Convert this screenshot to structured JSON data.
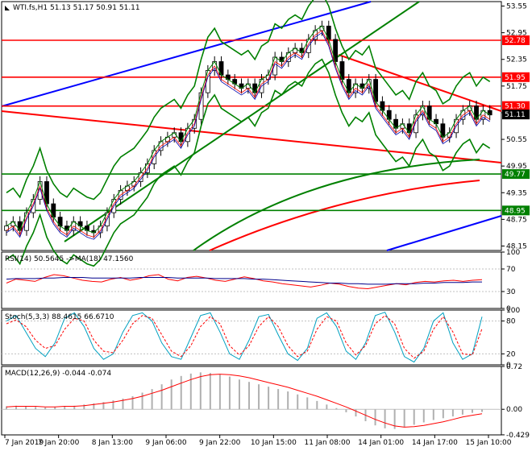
{
  "chart_data": [
    {
      "type": "candlestick",
      "title": "WTI.fs,H1  51.13 51.17 50.91 51.11",
      "symbol_text": "WTI.fs,H1",
      "ohlc_text": "51.13 51.17 50.91 51.11",
      "y_ticks": [
        "53.55",
        "52.95",
        "52.35",
        "51.75",
        "51.15",
        "50.55",
        "49.95",
        "49.35",
        "48.75",
        "48.15"
      ],
      "ylim": [
        48.05,
        53.65
      ],
      "horizontal_levels": [
        {
          "value": 52.78,
          "label": "52.78",
          "color": "#ff0000"
        },
        {
          "value": 51.95,
          "label": "51.95",
          "color": "#ff0000"
        },
        {
          "value": 51.3,
          "label": "51.30",
          "color": "#ff0000"
        },
        {
          "value": 49.77,
          "label": "49.77",
          "color": "#008000"
        },
        {
          "value": 48.95,
          "label": "48.95",
          "color": "#008000"
        }
      ],
      "current_price": {
        "value": 51.11,
        "label": "51.11"
      },
      "x_labels": [
        "7 Jan 2019",
        "7 Jan 20:00",
        "8 Jan 13:00",
        "9 Jan 06:00",
        "9 Jan 22:00",
        "10 Jan 15:00",
        "11 Jan 08:00",
        "14 Jan 01:00",
        "14 Jan 17:00",
        "15 Jan 10:00"
      ],
      "close_series": [
        48.6,
        48.7,
        48.5,
        48.9,
        49.2,
        49.6,
        49.1,
        48.8,
        48.6,
        48.5,
        48.7,
        48.6,
        48.5,
        48.45,
        48.6,
        48.9,
        49.2,
        49.4,
        49.5,
        49.6,
        49.8,
        50.0,
        50.3,
        50.5,
        50.6,
        50.7,
        50.5,
        50.8,
        51.0,
        51.6,
        52.1,
        52.3,
        52.0,
        51.9,
        51.8,
        51.7,
        51.8,
        51.6,
        51.9,
        52.0,
        52.4,
        52.3,
        52.5,
        52.6,
        52.5,
        52.8,
        53.0,
        53.1,
        52.8,
        52.3,
        51.9,
        51.6,
        51.8,
        51.7,
        51.9,
        51.4,
        51.2,
        51.0,
        50.8,
        50.9,
        50.7,
        51.1,
        51.3,
        51.0,
        50.9,
        50.6,
        50.7,
        51.0,
        51.2,
        51.3,
        51.0,
        51.2,
        51.1
      ]
    },
    {
      "type": "line",
      "title": "RSI(14) 50.5645  ->MA(18) 47.1560",
      "y_ticks": [
        "100",
        "70",
        "30",
        "0"
      ],
      "ylim": [
        0,
        100
      ],
      "series": [
        {
          "name": "RSI(14)",
          "color": "#ff0000",
          "values": [
            45,
            52,
            50,
            48,
            55,
            60,
            58,
            54,
            50,
            48,
            47,
            52,
            55,
            50,
            53,
            58,
            60,
            52,
            49,
            55,
            57,
            54,
            50,
            48,
            52,
            56,
            53,
            49,
            47,
            44,
            42,
            40,
            38,
            41,
            45,
            43,
            39,
            36,
            35,
            38,
            41,
            44,
            42,
            46,
            48,
            47,
            49,
            50,
            48,
            50,
            51
          ]
        },
        {
          "name": "MA(18)",
          "color": "#00008b",
          "values": [
            52,
            53,
            53,
            53,
            54,
            54,
            55,
            55,
            55,
            54,
            54,
            54,
            54,
            54,
            55,
            55,
            55,
            55,
            54,
            54,
            54,
            54,
            53,
            53,
            53,
            53,
            52,
            52,
            51,
            50,
            49,
            48,
            47,
            46,
            45,
            45,
            44,
            44,
            43,
            43,
            43,
            44,
            44,
            44,
            45,
            45,
            46,
            46,
            46,
            47,
            47
          ]
        }
      ]
    },
    {
      "type": "line",
      "title": "Stoch(5,3,3) 88.4615 66.6710",
      "y_ticks": [
        "100",
        "80",
        "20",
        "0"
      ],
      "ylim": [
        0,
        100
      ],
      "series": [
        {
          "name": "%K",
          "color": "#00a0c0",
          "values": [
            80,
            90,
            60,
            30,
            15,
            40,
            85,
            95,
            70,
            30,
            10,
            20,
            60,
            90,
            95,
            80,
            40,
            15,
            10,
            50,
            90,
            95,
            60,
            20,
            10,
            45,
            88,
            92,
            55,
            20,
            8,
            30,
            85,
            95,
            70,
            25,
            10,
            40,
            90,
            96,
            60,
            15,
            5,
            30,
            80,
            95,
            40,
            10,
            20,
            88
          ]
        },
        {
          "name": "%D",
          "color": "#ff0000",
          "values": [
            75,
            82,
            70,
            45,
            30,
            35,
            65,
            85,
            80,
            45,
            25,
            22,
            45,
            75,
            90,
            85,
            55,
            25,
            15,
            35,
            70,
            88,
            75,
            35,
            18,
            35,
            70,
            88,
            70,
            35,
            15,
            25,
            65,
            88,
            80,
            40,
            18,
            35,
            75,
            90,
            75,
            30,
            12,
            25,
            65,
            88,
            60,
            20,
            18,
            66
          ]
        }
      ]
    },
    {
      "type": "bar",
      "title": "MACD(12,26,9) -0.044 -0.074",
      "y_ticks": [
        "0.72",
        "0.00",
        "-0.429"
      ],
      "ylim": [
        -0.43,
        0.72
      ],
      "series": [
        {
          "name": "MACD",
          "color": "#c0c0c0",
          "values": [
            0.05,
            0.06,
            0.05,
            0.04,
            0.03,
            0.04,
            0.05,
            0.06,
            0.08,
            0.1,
            0.12,
            0.15,
            0.18,
            0.22,
            0.28,
            0.34,
            0.42,
            0.5,
            0.56,
            0.6,
            0.62,
            0.61,
            0.58,
            0.55,
            0.5,
            0.46,
            0.42,
            0.38,
            0.34,
            0.3,
            0.25,
            0.2,
            0.14,
            0.08,
            0.02,
            -0.05,
            -0.12,
            -0.2,
            -0.27,
            -0.32,
            -0.33,
            -0.3,
            -0.26,
            -0.22,
            -0.18,
            -0.15,
            -0.12,
            -0.09,
            -0.06,
            -0.044
          ]
        },
        {
          "name": "Signal",
          "color": "#ff0000",
          "values": [
            0.04,
            0.05,
            0.05,
            0.05,
            0.04,
            0.04,
            0.05,
            0.05,
            0.06,
            0.08,
            0.1,
            0.12,
            0.15,
            0.18,
            0.22,
            0.27,
            0.32,
            0.38,
            0.44,
            0.5,
            0.55,
            0.58,
            0.59,
            0.58,
            0.56,
            0.53,
            0.49,
            0.45,
            0.41,
            0.37,
            0.32,
            0.27,
            0.22,
            0.16,
            0.1,
            0.04,
            -0.03,
            -0.1,
            -0.17,
            -0.23,
            -0.28,
            -0.3,
            -0.29,
            -0.27,
            -0.24,
            -0.21,
            -0.17,
            -0.13,
            -0.1,
            -0.074
          ]
        }
      ]
    }
  ]
}
